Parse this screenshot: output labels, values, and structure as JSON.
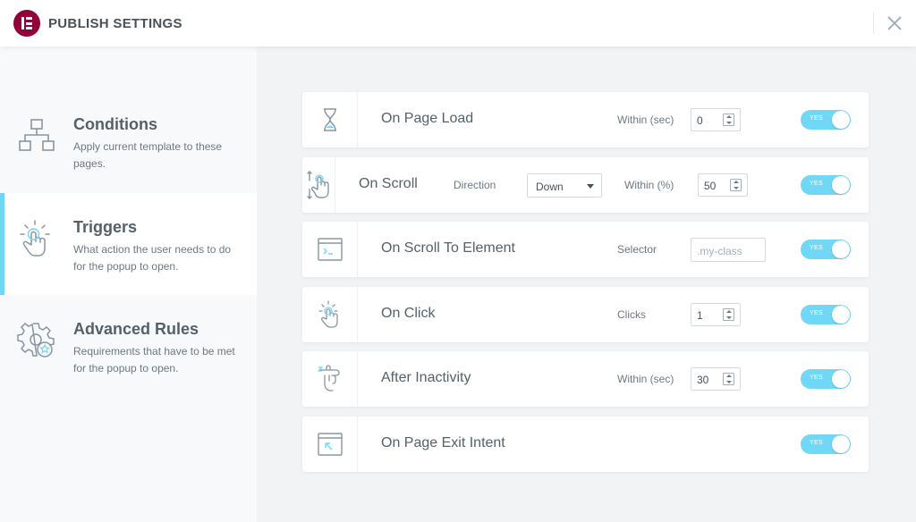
{
  "header": {
    "title": "PUBLISH SETTINGS"
  },
  "sidebar": {
    "tabs": [
      {
        "title": "Conditions",
        "description": "Apply current template to these pages.",
        "icon": "sitemap-icon"
      },
      {
        "title": "Triggers",
        "description": "What action the user needs to do for the popup to open.",
        "icon": "touch-icon"
      },
      {
        "title": "Advanced Rules",
        "description": "Requirements that have to be met for the popup to open.",
        "icon": "gear-star-icon"
      }
    ],
    "active_index": 1
  },
  "triggers": [
    {
      "name": "On Page Load",
      "icon": "hourglass-icon",
      "label": "Within (sec)",
      "value": "0",
      "enabled": "YES"
    },
    {
      "name": "On Scroll",
      "icon": "scroll-hand-icon",
      "direction_label": "Direction",
      "direction_value": "Down",
      "label": "Within (%)",
      "value": "50",
      "enabled": "YES"
    },
    {
      "name": "On Scroll To Element",
      "icon": "terminal-window-icon",
      "label": "Selector",
      "placeholder": ".my-class",
      "enabled": "YES"
    },
    {
      "name": "On Click",
      "icon": "click-hand-icon",
      "label": "Clicks",
      "value": "1",
      "enabled": "YES"
    },
    {
      "name": "After Inactivity",
      "icon": "idle-hand-icon",
      "label": "Within (sec)",
      "value": "30",
      "enabled": "YES"
    },
    {
      "name": "On Page Exit Intent",
      "icon": "exit-window-icon",
      "enabled": "YES"
    }
  ],
  "colors": {
    "accent": "#71d7f7",
    "brand": "#92003b",
    "text": "#556068"
  }
}
